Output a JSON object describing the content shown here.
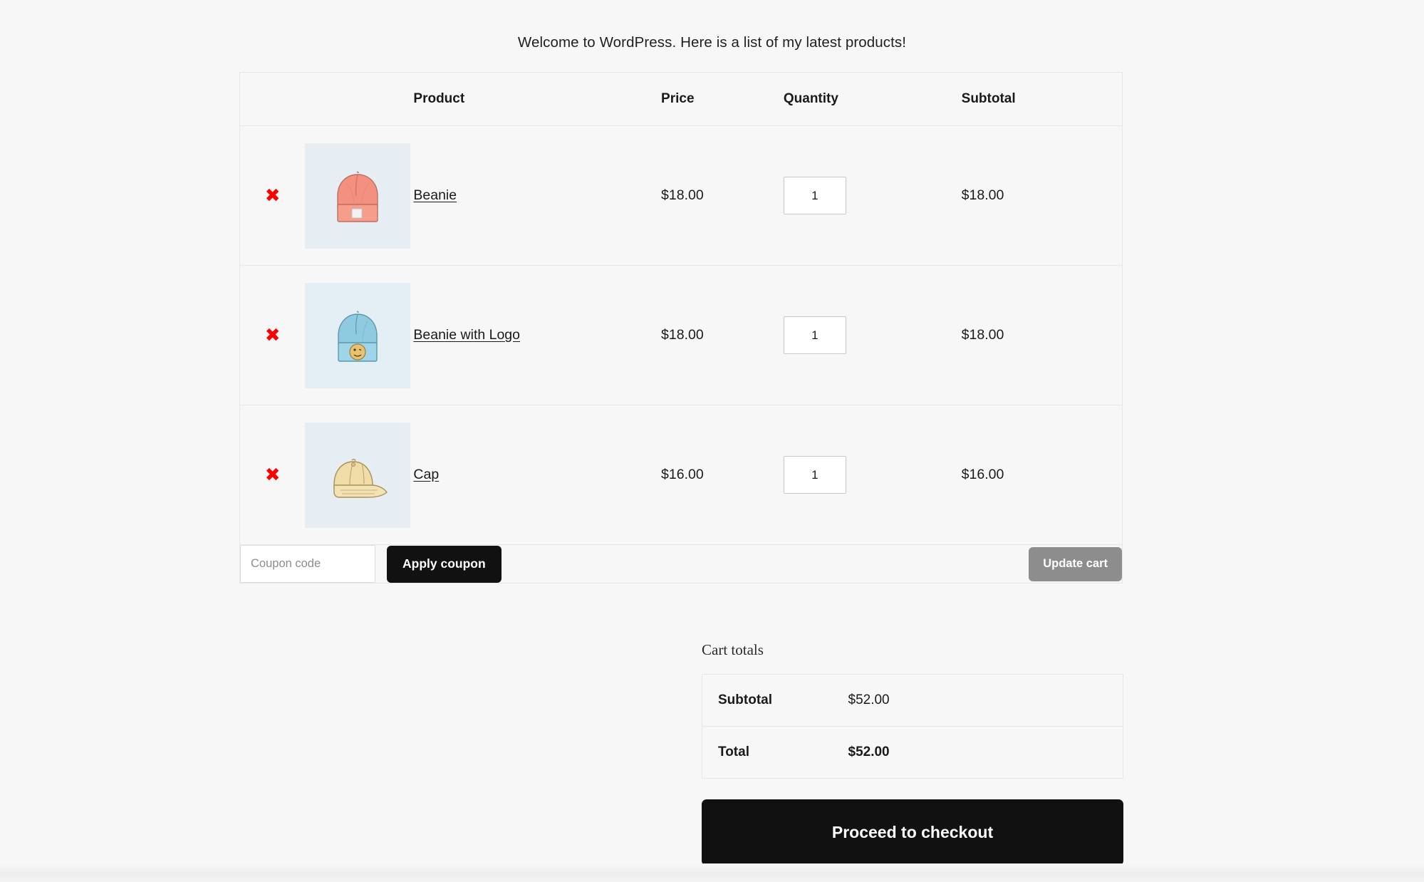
{
  "page": {
    "intro_text": "Welcome to WordPress. Here is a list of my latest products!",
    "background_color": "#f7f7f7"
  },
  "cart_table": {
    "headers": {
      "remove": "",
      "thumbnail": "",
      "product": "Product",
      "price": "Price",
      "quantity": "Quantity",
      "subtotal": "Subtotal"
    },
    "remove_icon_label": "✖",
    "remove_icon_color": "#ff0000",
    "rows": [
      {
        "name": "Beanie",
        "price": "$18.00",
        "quantity": "1",
        "subtotal": "$18.00",
        "thumb_icon": "beanie-pink-thumbnail"
      },
      {
        "name": "Beanie with Logo",
        "price": "$18.00",
        "quantity": "1",
        "subtotal": "$18.00",
        "thumb_icon": "beanie-blue-logo-thumbnail"
      },
      {
        "name": "Cap",
        "price": "$16.00",
        "quantity": "1",
        "subtotal": "$16.00",
        "thumb_icon": "cap-tan-thumbnail"
      }
    ]
  },
  "coupon": {
    "placeholder": "Coupon code",
    "value": "",
    "apply_label": "Apply coupon",
    "update_label": "Update cart",
    "apply_color": "#111111",
    "update_color": "#8d8d8d"
  },
  "totals": {
    "title": "Cart totals",
    "rows": [
      {
        "label": "Subtotal",
        "value": "$52.00"
      },
      {
        "label": "Total",
        "value": "$52.00"
      }
    ],
    "checkout_label": "Proceed to checkout",
    "checkout_color": "#111111"
  }
}
